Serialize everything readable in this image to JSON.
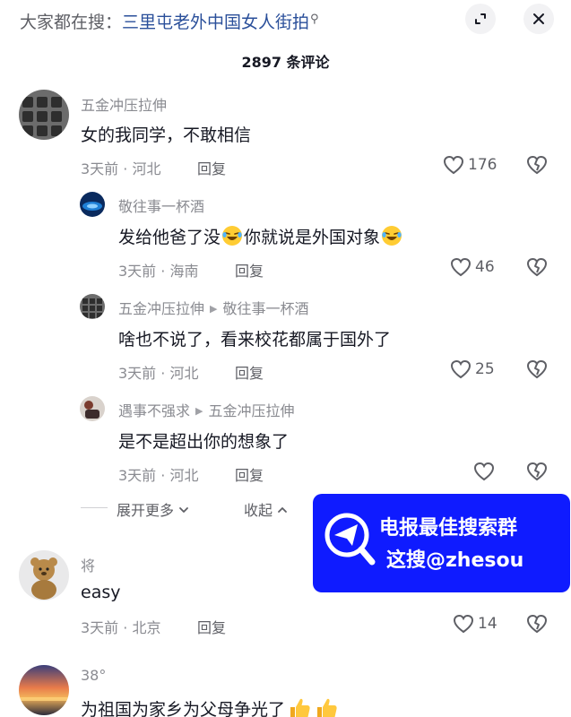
{
  "header": {
    "search_prefix": "大家都在搜：",
    "search_term": "三里屯老外中国女人街拍",
    "search_icon_glyph": "⚲"
  },
  "comments_title": "2897 条评论",
  "comments": [
    {
      "user": "五金冲压拉伸",
      "text": "女的我同学，不敢相信",
      "time_location": "3天前 · 河北",
      "reply_label": "回复",
      "likes": "176"
    }
  ],
  "replies": [
    {
      "user": "敬往事一杯酒",
      "text_part1": "发给他爸了没",
      "text_part2": "你就说是外国对象",
      "time_location": "3天前 · 海南",
      "reply_label": "回复",
      "likes": "46"
    },
    {
      "user": "五金冲压拉伸",
      "reply_to": "敬往事一杯酒",
      "text": "啥也不说了，看来校花都属于国外了",
      "time_location": "3天前 · 河北",
      "reply_label": "回复",
      "likes": "25"
    },
    {
      "user": "遇事不强求",
      "reply_to": "五金冲压拉伸",
      "text": "是不是超出你的想象了",
      "time_location": "3天前 · 河北",
      "reply_label": "回复",
      "likes": ""
    }
  ],
  "thread_controls": {
    "expand_more": "展开更多",
    "collapse": "收起"
  },
  "comments_more": [
    {
      "user": "将",
      "text": "easy",
      "time_location": "3天前 · 北京",
      "reply_label": "回复",
      "likes": "14"
    },
    {
      "user": "38°",
      "text": "为祖国为家乡为父母争光了"
    }
  ],
  "watermark": {
    "line1": "电报最佳搜索群",
    "line2": "这搜@zhesou",
    "bg_color": "#0f1bff"
  },
  "colors": {
    "search_term": "#2a4f9a",
    "primary_text": "#161823",
    "secondary_text": "#8a8b91"
  }
}
